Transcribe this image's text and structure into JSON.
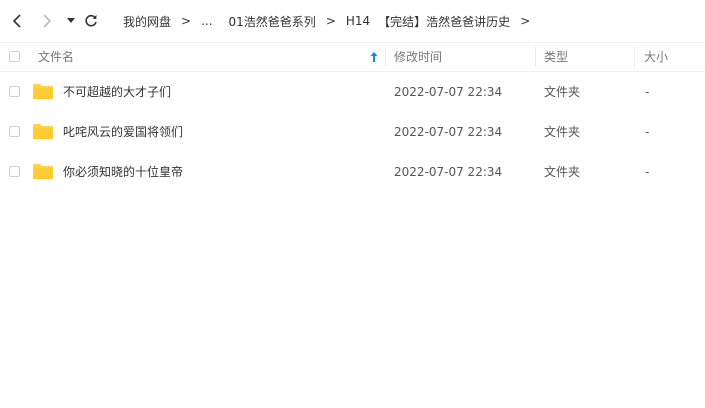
{
  "breadcrumb": {
    "items": [
      "我的网盘",
      "...",
      "01浩然爸爸系列",
      "H14",
      "【完结】浩然爸爸讲历史"
    ],
    "separator": ">"
  },
  "columns": {
    "name": "文件名",
    "modified": "修改时间",
    "type": "类型",
    "size": "大小"
  },
  "files": [
    {
      "name": "不可超越的大才子们",
      "modified": "2022-07-07 22:34",
      "type": "文件夹",
      "size": "-"
    },
    {
      "name": "叱咤风云的爱国将领们",
      "modified": "2022-07-07 22:34",
      "type": "文件夹",
      "size": "-"
    },
    {
      "name": "你必须知晓的十位皇帝",
      "modified": "2022-07-07 22:34",
      "type": "文件夹",
      "size": "-"
    }
  ],
  "colors": {
    "folder": "#ffd243",
    "sort_arrow": "#0b8ae8",
    "border": "#f0f0f0"
  },
  "icons": [
    "back-icon",
    "forward-icon",
    "dropdown-icon",
    "refresh-icon",
    "folder-icon",
    "sort-up-icon"
  ]
}
